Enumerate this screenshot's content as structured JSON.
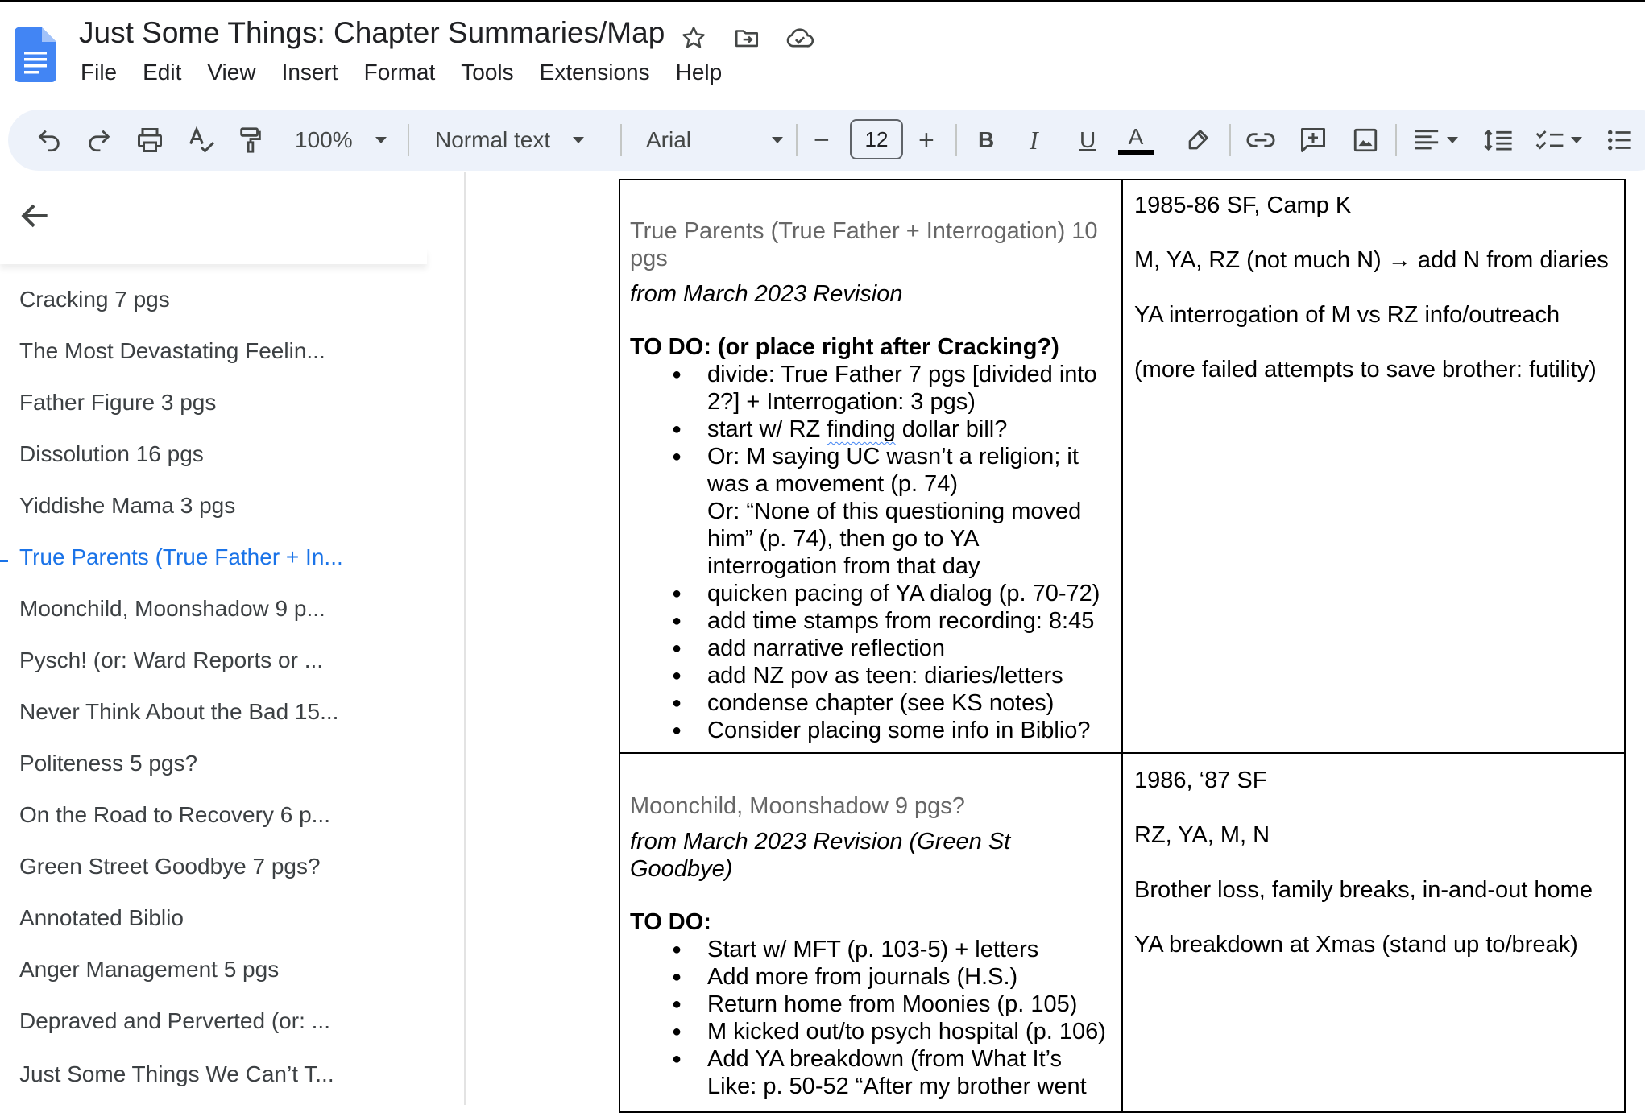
{
  "app": {
    "title": "Just Some Things: Chapter Summaries/Map",
    "menu": [
      "File",
      "Edit",
      "View",
      "Insert",
      "Format",
      "Tools",
      "Extensions",
      "Help"
    ]
  },
  "toolbar": {
    "zoom": "100%",
    "style": "Normal text",
    "font": "Arial",
    "font_size": "12",
    "bold": "B",
    "italic": "I",
    "underline": "U",
    "text_color_letter": "A",
    "minus": "−",
    "plus": "+"
  },
  "sidebar": {
    "items": [
      "Cracking 7 pgs",
      "The Most Devastating Feelin...",
      "Father Figure 3 pgs",
      "Dissolution 16 pgs",
      "Yiddishe Mama 3 pgs",
      "True Parents (True Father + In...",
      "Moonchild, Moonshadow 9 p...",
      "Pysch! (or: Ward Reports or ...",
      "Never Think About the Bad 15...",
      "Politeness 5 pgs?",
      "On the Road to Recovery 6 p...",
      "Green Street Goodbye 7 pgs?",
      "Annotated Biblio",
      "Anger Management 5 pgs",
      "Depraved and Perverted (or: ...",
      "Just Some Things We Can’t T..."
    ],
    "active_index": 5
  },
  "doc": {
    "row1": {
      "heading": "True Parents (True Father + Interrogation) 10 pgs",
      "revision": "from March 2023 Revision",
      "todo": "TO DO: (or place right after Cracking?)",
      "bullets": [
        "divide: True Father 7 pgs [divided into 2?] + Interrogation: 3 pgs)",
        "start w/ RZ ",
        "finding",
        " dollar bill?",
        "Or: M saying UC wasn’t a religion; it was a movement (p. 74)",
        "Or: “None of this questioning moved him” (p. 74), then go to YA interrogation from that day",
        "quicken pacing of YA dialog (p. 70-72)",
        "add time stamps from recording: 8:45",
        "add narrative reflection",
        "add NZ pov as teen: diaries/letters",
        "condense chapter (see KS notes)",
        "Consider placing some info in Biblio?"
      ],
      "notes": [
        "1985-86 SF, Camp K",
        "M, YA, RZ (not much N) → add N from diaries",
        "YA interrogation of M vs RZ info/outreach",
        "(more failed attempts to save brother: futility)"
      ]
    },
    "row2": {
      "heading": "Moonchild, Moonshadow 9 pgs?",
      "revision": "from March 2023 Revision (Green St Goodbye)",
      "todo": "TO DO:",
      "bullets": [
        "Start w/ MFT (p. 103-5) + letters",
        "Add more from journals (H.S.)",
        "Return home from Moonies (p. 105)",
        "M kicked out/to psych hospital (p. 106)",
        "Add YA breakdown (from What It’s Like: p. 50-52 “After my brother went"
      ],
      "notes": [
        "1986, ‘87  SF",
        "RZ, YA, M, N",
        "Brother loss, family breaks, in-and-out home",
        "YA breakdown at Xmas (stand up to/break)"
      ]
    }
  },
  "colors": {
    "accent": "#1a73e8",
    "doc_icon": "#4285f4",
    "toolbar_bg": "#edf2fa"
  }
}
